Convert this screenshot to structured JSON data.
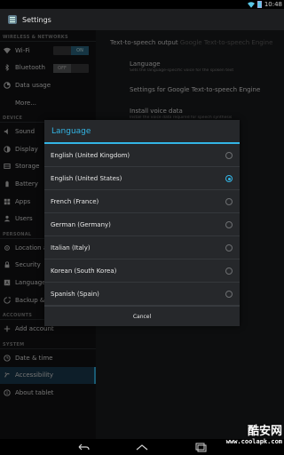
{
  "status_bar": {
    "time": "10:48"
  },
  "action_bar": {
    "title": "Settings"
  },
  "sidebar": {
    "sections": [
      {
        "header": "WIRELESS & NETWORKS",
        "items": [
          {
            "label": "Wi-Fi",
            "icon": "wifi-icon",
            "toggle": "ON"
          },
          {
            "label": "Bluetooth",
            "icon": "bluetooth-icon",
            "toggle": "OFF"
          },
          {
            "label": "Data usage",
            "icon": "data-usage-icon"
          },
          {
            "label": "More...",
            "icon": ""
          }
        ]
      },
      {
        "header": "DEVICE",
        "items": [
          {
            "label": "Sound",
            "icon": "sound-icon"
          },
          {
            "label": "Display",
            "icon": "display-icon"
          },
          {
            "label": "Storage",
            "icon": "storage-icon"
          },
          {
            "label": "Battery",
            "icon": "battery-icon"
          },
          {
            "label": "Apps",
            "icon": "apps-icon"
          },
          {
            "label": "Users",
            "icon": "users-icon"
          }
        ]
      },
      {
        "header": "PERSONAL",
        "items": [
          {
            "label": "Location a",
            "icon": "location-icon"
          },
          {
            "label": "Security",
            "icon": "security-icon"
          },
          {
            "label": "Language",
            "icon": "language-icon"
          },
          {
            "label": "Backup & r",
            "icon": "backup-icon"
          }
        ]
      },
      {
        "header": "ACCOUNTS",
        "items": [
          {
            "label": "Add account",
            "icon": "add-icon"
          }
        ]
      },
      {
        "header": "SYSTEM",
        "items": [
          {
            "label": "Date & time",
            "icon": "clock-icon"
          },
          {
            "label": "Accessibility",
            "icon": "accessibility-icon",
            "selected": true
          },
          {
            "label": "About tablet",
            "icon": "info-icon"
          }
        ]
      }
    ]
  },
  "right_pane": {
    "tts_label": "Text-to-speech output",
    "tts_engine": "Google Text-to-speech Engine",
    "items": [
      {
        "title": "Language",
        "subtitle": "Sets the language-specific voice for the spoken text"
      },
      {
        "title": "Settings for Google Text-to-speech Engine",
        "subtitle": ""
      },
      {
        "title": "Install voice data",
        "subtitle": "Install the voice data required for speech synthesis"
      }
    ]
  },
  "dialog": {
    "title": "Language",
    "options": [
      {
        "label": "English (United Kingdom)",
        "checked": false
      },
      {
        "label": "English (United States)",
        "checked": true
      },
      {
        "label": "French (France)",
        "checked": false
      },
      {
        "label": "German (Germany)",
        "checked": false
      },
      {
        "label": "Italian (Italy)",
        "checked": false
      },
      {
        "label": "Korean (South Korea)",
        "checked": false
      },
      {
        "label": "Spanish (Spain)",
        "checked": false
      }
    ],
    "cancel_label": "Cancel"
  },
  "watermark": {
    "text_cn": "酷安网",
    "url": "www.coolapk.com"
  },
  "colors": {
    "accent": "#33b5e5",
    "selected_bg": "#1b3d52"
  }
}
